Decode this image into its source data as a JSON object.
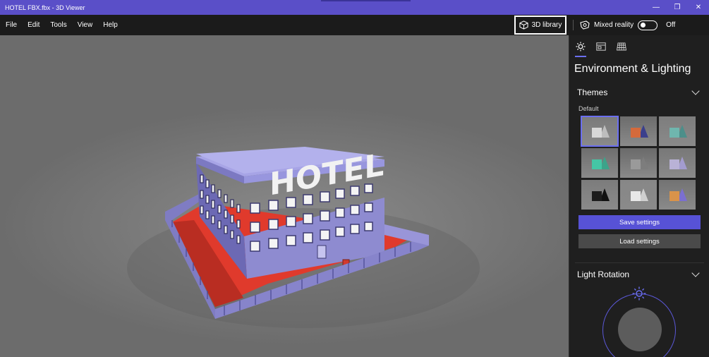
{
  "window": {
    "title": "HOTEL FBX.fbx - 3D Viewer",
    "controls": {
      "minimize": "—",
      "restore": "❐",
      "close": "✕"
    },
    "accent_color": "#5a4fc8"
  },
  "menu": {
    "items": [
      {
        "label": "File"
      },
      {
        "label": "Edit"
      },
      {
        "label": "Tools"
      },
      {
        "label": "View"
      },
      {
        "label": "Help"
      }
    ],
    "library_button": "3D library",
    "mixed_reality_label": "Mixed reality",
    "mixed_reality_state": "Off"
  },
  "viewport": {
    "model_sign_text": "HOTEL",
    "colors": {
      "building": "#8e8bd0",
      "roof": "#a7a4e6",
      "ground": "#e03a2c",
      "fence": "#7f7cc3"
    }
  },
  "panel": {
    "tabs": [
      {
        "icon": "sun-icon"
      },
      {
        "icon": "stats-icon"
      },
      {
        "icon": "grid-icon"
      }
    ],
    "title": "Environment & Lighting",
    "themes": {
      "heading": "Themes",
      "selected_label": "Default",
      "items": [
        {
          "shape_color": "#d8d8d8",
          "accent": "#bdbdbd",
          "bg": "#7a7a7a"
        },
        {
          "shape_color": "#d46a3c",
          "accent": "#3b3f8c",
          "bg": "#6c6c6c"
        },
        {
          "shape_color": "#6fb6ae",
          "accent": "#4c8f8a",
          "bg": "#7d7d7d"
        },
        {
          "shape_color": "#45c6a5",
          "accent": "#3da38a",
          "bg": "#6e6e6e"
        },
        {
          "shape_color": "#9a9a9a",
          "accent": "#7d7d7d",
          "bg": "#6a6a6a"
        },
        {
          "shape_color": "#b9b2d6",
          "accent": "#a39ccf",
          "bg": "#787878"
        },
        {
          "shape_color": "#1d1d1d",
          "accent": "#111111",
          "bg": "#7c7c7c"
        },
        {
          "shape_color": "#e8e8e8",
          "accent": "#d0d0d0",
          "bg": "#878787"
        },
        {
          "shape_color": "#d9934a",
          "accent": "#7b6fd0",
          "bg": "#737373"
        }
      ],
      "save_button": "Save settings",
      "load_button": "Load settings"
    },
    "light_rotation": {
      "heading": "Light Rotation"
    },
    "accent": "#5752d6"
  }
}
